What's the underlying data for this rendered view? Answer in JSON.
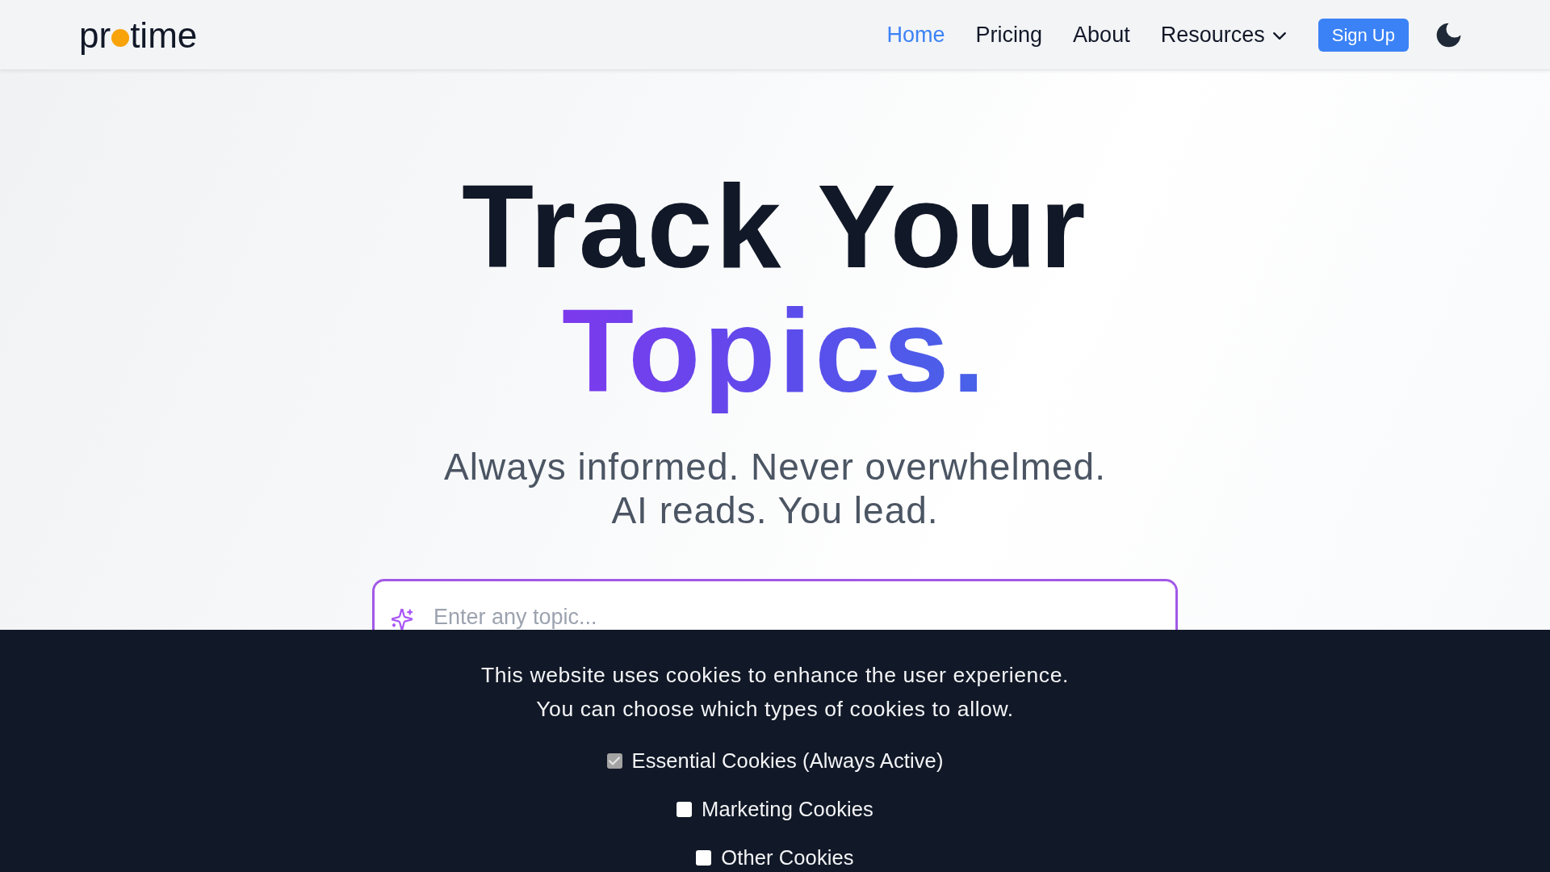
{
  "navbar": {
    "logo": {
      "text_start": "pr",
      "text_end": "time"
    },
    "links": [
      {
        "label": "Home",
        "selected": true,
        "kind": "link"
      },
      {
        "label": "Pricing",
        "selected": false,
        "kind": "link"
      },
      {
        "label": "About",
        "selected": false,
        "kind": "link"
      },
      {
        "label": "Resources",
        "selected": false,
        "kind": "dropdown"
      }
    ],
    "sign_up_button": {
      "label": "Sign Up"
    }
  },
  "hero": {
    "headline": "Track Your",
    "headline_highlight": "Topics.",
    "tagline": [
      "Always informed. Never overwhelmed.",
      "AI reads. You lead."
    ]
  },
  "search": {
    "placeholder": "Enter any topic..."
  },
  "cookie_banner": {
    "message": [
      "This website uses cookies to enhance the user experience.",
      "You can choose which types of cookies to allow."
    ],
    "options": [
      {
        "label": "Essential Cookies (Always Active)",
        "checked": true,
        "disabled": true
      },
      {
        "label": "Marketing Cookies",
        "checked": false,
        "disabled": false
      },
      {
        "label": "Other Cookies",
        "checked": false,
        "disabled": false
      }
    ]
  }
}
